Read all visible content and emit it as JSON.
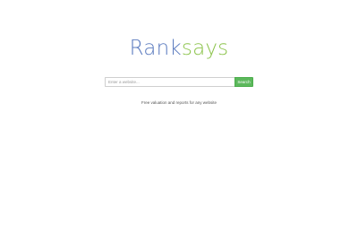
{
  "logo": {
    "part_a": "Rank",
    "part_b": "says"
  },
  "search": {
    "placeholder": "Enter a website...",
    "value": "",
    "button_label": "Search"
  },
  "tagline": "Free valuation and reports for any website",
  "colors": {
    "logo_blue": "#5b7bbf",
    "logo_green": "#8bc34a",
    "button_green": "#5cb85c"
  }
}
